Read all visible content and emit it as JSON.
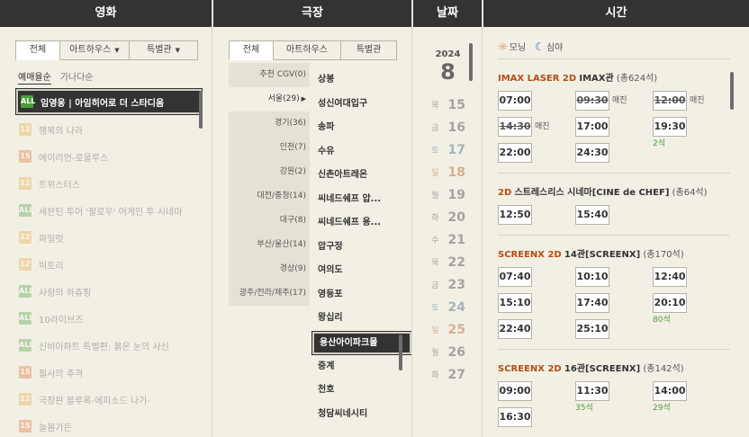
{
  "headers": {
    "movie": "영화",
    "theater": "극장",
    "date": "날짜",
    "time": "시간"
  },
  "movie_tabs": [
    {
      "label": "전체",
      "active": true
    },
    {
      "label": "아트하우스",
      "active": false
    },
    {
      "label": "특별관",
      "active": false
    }
  ],
  "movie_sorts": [
    {
      "label": "예매율순",
      "active": true
    },
    {
      "label": "가나다순",
      "active": false
    }
  ],
  "movies": [
    {
      "rating": "ALL",
      "rating_class": "all",
      "title": "임영웅 | 아임히어로 더 스타디움",
      "selected": true
    },
    {
      "rating": "12",
      "rating_class": "r12",
      "title": "행복의 나라",
      "selected": false
    },
    {
      "rating": "15",
      "rating_class": "r15",
      "title": "에이리언-로물루스",
      "selected": false
    },
    {
      "rating": "12",
      "rating_class": "r12",
      "title": "트위스터스",
      "selected": false
    },
    {
      "rating": "ALL",
      "rating_class": "all",
      "title": "세븐틴 투어 '팔로우' 어게인 투 시네마",
      "selected": false
    },
    {
      "rating": "12",
      "rating_class": "r12",
      "title": "파일럿",
      "selected": false
    },
    {
      "rating": "12",
      "rating_class": "r12",
      "title": "빅토리",
      "selected": false
    },
    {
      "rating": "ALL",
      "rating_class": "all",
      "title": "사랑의 하츄핑",
      "selected": false
    },
    {
      "rating": "ALL",
      "rating_class": "all",
      "title": "10라이브즈",
      "selected": false
    },
    {
      "rating": "ALL",
      "rating_class": "all",
      "title": "신비아파트 특별편: 붉은 눈의 사신",
      "selected": false
    },
    {
      "rating": "15",
      "rating_class": "r15",
      "title": "필사의 추격",
      "selected": false
    },
    {
      "rating": "12",
      "rating_class": "r12",
      "title": "극장판 블루록-에피소드 나기-",
      "selected": false
    },
    {
      "rating": "15",
      "rating_class": "r15",
      "title": "늘봄가든",
      "selected": false
    }
  ],
  "theater_tabs": [
    {
      "label": "전체",
      "active": true
    },
    {
      "label": "아트하우스",
      "active": false
    },
    {
      "label": "특별관",
      "active": false
    }
  ],
  "regions": [
    {
      "label": "추천 CGV(0)",
      "selected": false
    },
    {
      "label": "서울(29)",
      "selected": true,
      "arrow": "▶"
    },
    {
      "label": "경기(36)",
      "selected": false
    },
    {
      "label": "인천(7)",
      "selected": false
    },
    {
      "label": "강원(2)",
      "selected": false
    },
    {
      "label": "대전/충청(14)",
      "selected": false
    },
    {
      "label": "대구(8)",
      "selected": false
    },
    {
      "label": "부산/울산(14)",
      "selected": false
    },
    {
      "label": "경상(9)",
      "selected": false
    },
    {
      "label": "광주/전라/제주(17)",
      "selected": false
    }
  ],
  "theaters": [
    {
      "label": "상봉",
      "selected": false
    },
    {
      "label": "성신여대입구",
      "selected": false
    },
    {
      "label": "송파",
      "selected": false
    },
    {
      "label": "수유",
      "selected": false
    },
    {
      "label": "신촌아트레온",
      "selected": false
    },
    {
      "label": "씨네드쉐프 압...",
      "selected": false
    },
    {
      "label": "씨네드쉐프 용...",
      "selected": false
    },
    {
      "label": "압구정",
      "selected": false
    },
    {
      "label": "여의도",
      "selected": false
    },
    {
      "label": "영등포",
      "selected": false
    },
    {
      "label": "왕십리",
      "selected": false
    },
    {
      "label": "용산아이파크몰",
      "selected": true
    },
    {
      "label": "중계",
      "selected": false
    },
    {
      "label": "천호",
      "selected": false
    },
    {
      "label": "청담씨네시티",
      "selected": false
    }
  ],
  "date": {
    "year": "2024",
    "month": "8"
  },
  "days": [
    {
      "dow": "목",
      "num": "15",
      "kind": "weekday"
    },
    {
      "dow": "금",
      "num": "16",
      "kind": "weekday"
    },
    {
      "dow": "토",
      "num": "17",
      "kind": "sat"
    },
    {
      "dow": "일",
      "num": "18",
      "kind": "sun"
    },
    {
      "dow": "월",
      "num": "19",
      "kind": "weekday"
    },
    {
      "dow": "화",
      "num": "20",
      "kind": "weekday"
    },
    {
      "dow": "수",
      "num": "21",
      "kind": "weekday"
    },
    {
      "dow": "목",
      "num": "22",
      "kind": "weekday"
    },
    {
      "dow": "금",
      "num": "23",
      "kind": "weekday"
    },
    {
      "dow": "토",
      "num": "24",
      "kind": "sat"
    },
    {
      "dow": "일",
      "num": "25",
      "kind": "sun"
    },
    {
      "dow": "월",
      "num": "26",
      "kind": "weekday"
    },
    {
      "dow": "화",
      "num": "27",
      "kind": "weekday"
    }
  ],
  "daynight": {
    "morning": "모닝",
    "night": "심야"
  },
  "sessions": [
    {
      "format": "IMAX LASER 2D",
      "hall": "IMAX관",
      "seats": "(총624석)",
      "times": [
        {
          "time": "07:00",
          "closed": false,
          "note": "",
          "remain": ""
        },
        {
          "time": "09:30",
          "closed": true,
          "note": "매진",
          "remain": ""
        },
        {
          "time": "12:00",
          "closed": true,
          "note": "매진",
          "remain": ""
        },
        {
          "time": "14:30",
          "closed": true,
          "note": "매진",
          "remain": ""
        },
        {
          "time": "17:00",
          "closed": false,
          "note": "",
          "remain": ""
        },
        {
          "time": "19:30",
          "closed": false,
          "note": "",
          "remain": "2석"
        },
        {
          "time": "22:00",
          "closed": false,
          "note": "",
          "remain": ""
        },
        {
          "time": "24:30",
          "closed": false,
          "note": "",
          "remain": ""
        }
      ]
    },
    {
      "format": "2D",
      "hall": "스트레스리스 시네마[CINE de CHEF]",
      "seats": "(총64석)",
      "times": [
        {
          "time": "12:50",
          "closed": false,
          "note": "",
          "remain": ""
        },
        {
          "time": "15:40",
          "closed": false,
          "note": "",
          "remain": ""
        }
      ]
    },
    {
      "format": "SCREENX 2D",
      "hall": "14관[SCREENX]",
      "seats": "(총170석)",
      "times": [
        {
          "time": "07:40",
          "closed": false,
          "note": "",
          "remain": ""
        },
        {
          "time": "10:10",
          "closed": false,
          "note": "",
          "remain": ""
        },
        {
          "time": "12:40",
          "closed": false,
          "note": "",
          "remain": ""
        },
        {
          "time": "15:10",
          "closed": false,
          "note": "",
          "remain": ""
        },
        {
          "time": "17:40",
          "closed": false,
          "note": "",
          "remain": ""
        },
        {
          "time": "20:10",
          "closed": false,
          "note": "",
          "remain": "80석"
        },
        {
          "time": "22:40",
          "closed": false,
          "note": "",
          "remain": ""
        },
        {
          "time": "25:10",
          "closed": false,
          "note": "",
          "remain": ""
        }
      ]
    },
    {
      "format": "SCREENX 2D",
      "hall": "16관[SCREENX]",
      "seats": "(총142석)",
      "times": [
        {
          "time": "09:00",
          "closed": false,
          "note": "",
          "remain": ""
        },
        {
          "time": "11:30",
          "closed": false,
          "note": "",
          "remain": "35석"
        },
        {
          "time": "14:00",
          "closed": false,
          "note": "",
          "remain": "29석"
        },
        {
          "time": "16:30",
          "closed": false,
          "note": "",
          "remain": ""
        }
      ]
    }
  ]
}
